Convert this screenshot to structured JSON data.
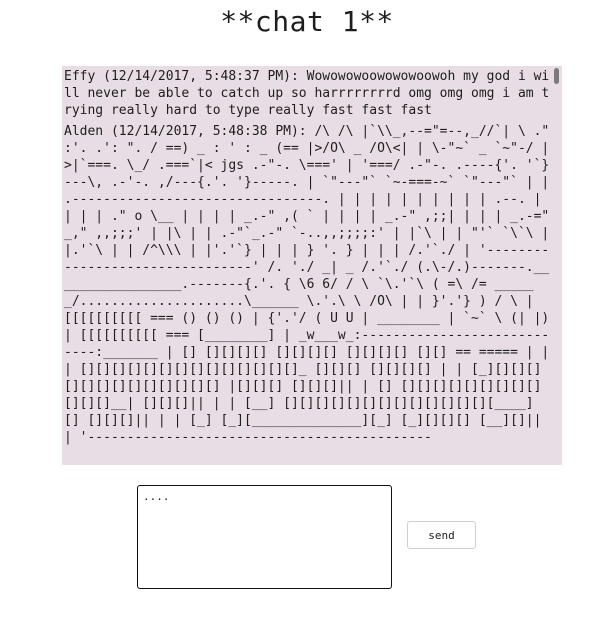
{
  "page": {
    "title": "**chat 1**"
  },
  "chat": {
    "messages": [
      {
        "text": "Effy (12/14/2017, 5:48:37 PM): Wowowowoowowowoowoh my god i will never be able to catch up so harrrrrrrrd omg omg omg i am trying really hard to type really fast fast fast"
      },
      {
        "text": "Alden (12/14/2017, 5:48:38 PM): /\\ /\\ |`\\\\_,--=\"=--,_//`| \\ .\" :'. .': \". / ==) _ : ' : _ (== |>/O\\ _ /O\\<| | \\-\"~` _ `~\"-/ | >|`===. \\_/ .===`|< jgs .-\"-. \\===' | '===/ .-\"-. .----{'. '`}---\\, .-'-. ,/---{.'. '}-----. | `\"---\"` `~-===-~` `\"---\"` | | .--------------------------------. | | | | | | | | | | .--. | | | | .\" o \\__ | | | | _.-\" ,( ` | | | | _.-\" ,;;| | | | _.-=\" _,\" ,,;;;' | |\\ | | .-\"`_.-\" `-..,,;;;;:' | |`\\ | | \"'` `\\`\\ | |.'`\\ | | /^\\\\\\ | |'.'`} | | | } '. } | | | /.'`./ | '--------------------------------' /. './ _| _ /.'`./ (.\\-/.)-------._________________.-------{.'. { \\6 6/ / \\ `\\.'`\\ ( =\\ /= ______/.....................\\______ \\.'.\\ \\ /O\\ | | }'.'} ) / \\ | [[[[[[[[[[ === () () () | {'.'/ ( U U | ________ | `~` \\ (| |)| [[[[[[[[[[ === [________] | _w___w_:----------------------------:_______ | [] [][][][] [][][][] [][][][] [][] == ===== | | | [][][][][][][][][][][][][][]_ [][][] [][][][] | | [_][][][][][][][][][][][][][] |[][][] [][][]|| | [] [][][][][][][][][][][][]__| [][][]|| | | [__] [][][][][][][][][][][][][][____] [] [][][]|| | | [_] [_][______________][_] [_][][][] [__][]|| | '--------------------------------------------"
      }
    ]
  },
  "compose": {
    "value": "...."
  },
  "send_label": "send"
}
